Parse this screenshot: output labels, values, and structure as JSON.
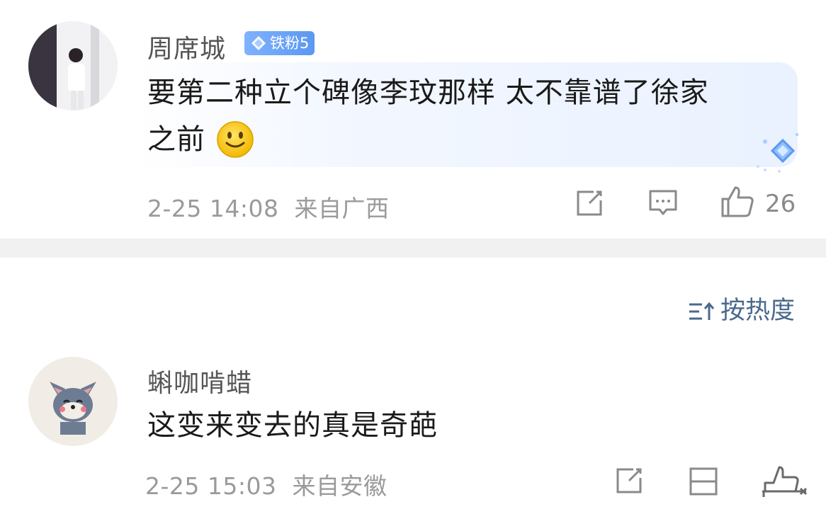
{
  "comments": [
    {
      "username": "周席城",
      "badge": "铁粉5",
      "text_line1": "要第二种立个碑像李玟那样 太不靠谱了徐家",
      "text_line2": "之前",
      "emoji": "smile-emoji",
      "time": "2-25 14:08",
      "location": "来自广西",
      "likes": "26"
    },
    {
      "username": "蝌咖啃蜡",
      "text": "这变来变去的真是奇葩",
      "time": "2-25 15:03",
      "location": "来自安徽"
    }
  ],
  "sort": {
    "label": "按热度"
  },
  "colors": {
    "badge": "#6aa3f5",
    "sort": "#4a6a8d",
    "meta": "#9a9a9a",
    "divider": "#f1f1f1"
  }
}
